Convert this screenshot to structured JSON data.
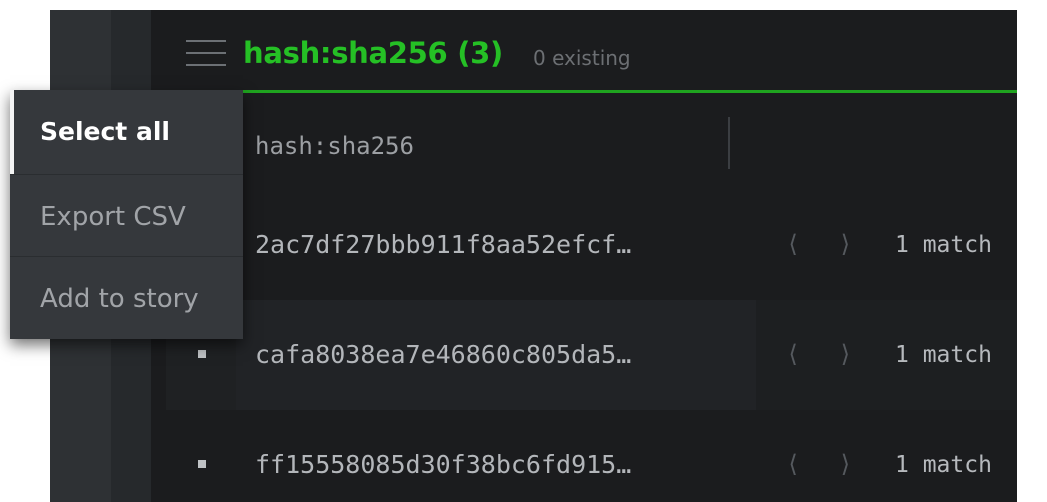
{
  "header": {
    "title": "hash:sha256 (3)",
    "subtitle": "0 existing",
    "accent_color": "#25c025",
    "menu_icon": "hamburger-icon"
  },
  "table": {
    "column_header": "hash:sha256",
    "rows": [
      {
        "hash": "2ac7df27bbb911f8aa52efcf…",
        "matches": "1 match",
        "prev_icon": "chevron-left-icon",
        "next_icon": "chevron-right-icon"
      },
      {
        "hash": "cafa8038ea7e46860c805da5…",
        "matches": "1 match",
        "prev_icon": "chevron-left-icon",
        "next_icon": "chevron-right-icon"
      },
      {
        "hash": "ff15558085d30f38bc6fd915…",
        "matches": "1 match",
        "prev_icon": "chevron-left-icon",
        "next_icon": "chevron-right-icon"
      }
    ]
  },
  "dropdown": {
    "items": [
      {
        "label": "Select all",
        "active": true
      },
      {
        "label": "Export CSV",
        "active": false
      },
      {
        "label": "Add to story",
        "active": false
      }
    ]
  }
}
